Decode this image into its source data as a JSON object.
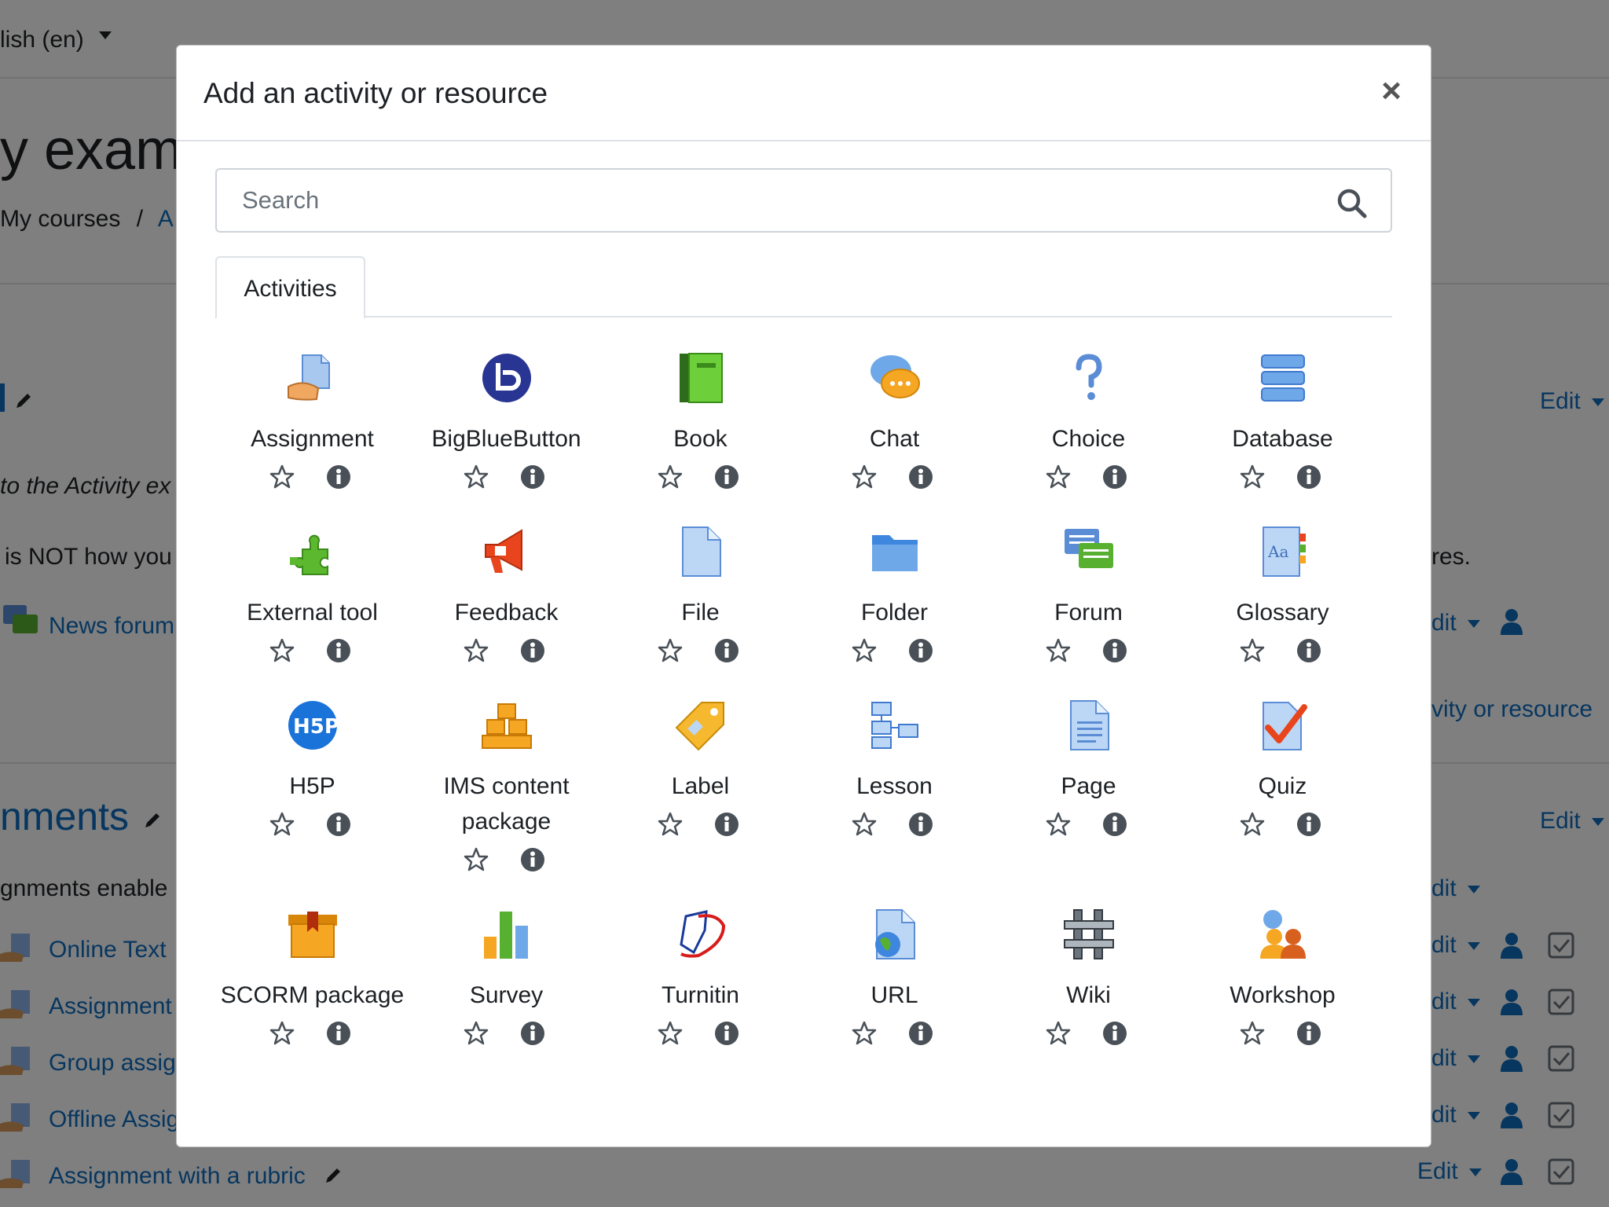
{
  "background": {
    "language": "lish (en)",
    "course_title": "y exam",
    "breadcrumb_my_courses": "My courses",
    "breadcrumb_sep": "/",
    "breadcrumb_next": "A",
    "intro_text": "to the Activity ex",
    "notice_text": "is NOT how you",
    "notice_text_right": "res.",
    "news_forum": "News forum",
    "add_activity_link": "vity or resource",
    "section_title": "nments",
    "section_desc": "gnments enable",
    "edit_label": "Edit",
    "edit_partial": "dit",
    "rows": [
      "Online Text",
      "Assignment",
      "Group assig",
      "Offline Assig",
      "Assignment with a rubric"
    ]
  },
  "modal": {
    "title": "Add an activity or resource",
    "close_label": "×",
    "search_placeholder": "Search",
    "tab_label": "Activities",
    "items": [
      {
        "name": "Assignment",
        "icon": "assignment-icon"
      },
      {
        "name": "BigBlueButton",
        "icon": "bigbluebutton-icon"
      },
      {
        "name": "Book",
        "icon": "book-icon"
      },
      {
        "name": "Chat",
        "icon": "chat-icon"
      },
      {
        "name": "Choice",
        "icon": "choice-icon"
      },
      {
        "name": "Database",
        "icon": "database-icon"
      },
      {
        "name": "External tool",
        "icon": "external-tool-icon"
      },
      {
        "name": "Feedback",
        "icon": "feedback-icon"
      },
      {
        "name": "File",
        "icon": "file-icon"
      },
      {
        "name": "Folder",
        "icon": "folder-icon"
      },
      {
        "name": "Forum",
        "icon": "forum-icon"
      },
      {
        "name": "Glossary",
        "icon": "glossary-icon"
      },
      {
        "name": "H5P",
        "icon": "h5p-icon"
      },
      {
        "name": "IMS content package",
        "icon": "ims-content-package-icon"
      },
      {
        "name": "Label",
        "icon": "label-icon"
      },
      {
        "name": "Lesson",
        "icon": "lesson-icon"
      },
      {
        "name": "Page",
        "icon": "page-icon"
      },
      {
        "name": "Quiz",
        "icon": "quiz-icon"
      },
      {
        "name": "SCORM package",
        "icon": "scorm-package-icon"
      },
      {
        "name": "Survey",
        "icon": "survey-icon"
      },
      {
        "name": "Turnitin",
        "icon": "turnitin-icon"
      },
      {
        "name": "URL",
        "icon": "url-icon"
      },
      {
        "name": "Wiki",
        "icon": "wiki-icon"
      },
      {
        "name": "Workshop",
        "icon": "workshop-icon"
      }
    ]
  },
  "colors": {
    "link": "#0f6cbf",
    "icon_gray": "#495057",
    "overlay": "rgba(0,0,0,0.5)"
  }
}
